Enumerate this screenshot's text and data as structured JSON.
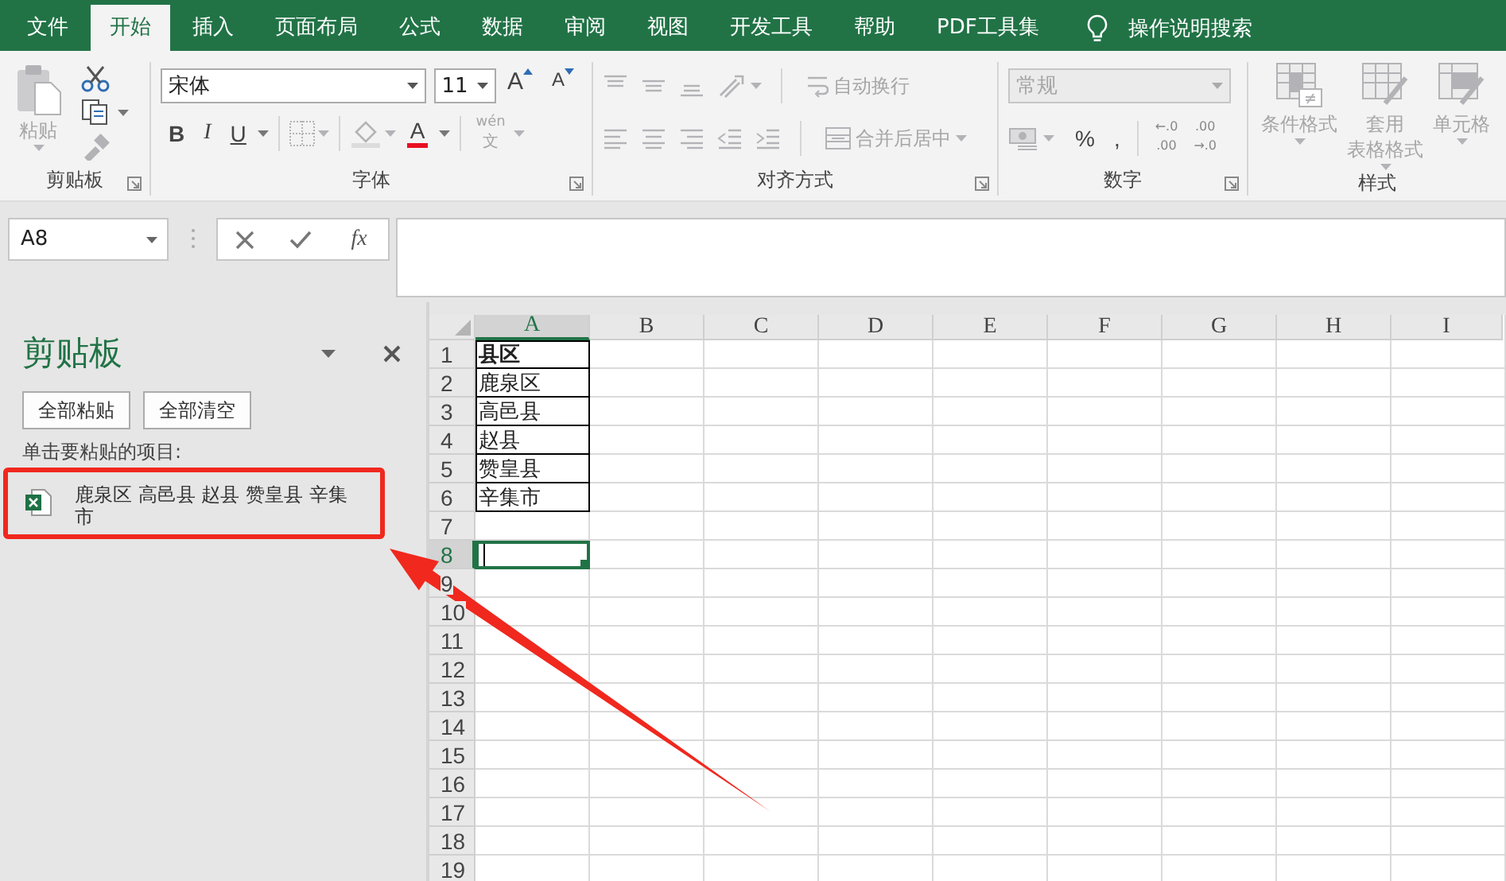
{
  "tabs": [
    {
      "label": "文件",
      "selected": false
    },
    {
      "label": "开始",
      "selected": true
    },
    {
      "label": "插入",
      "selected": false
    },
    {
      "label": "页面布局",
      "selected": false
    },
    {
      "label": "公式",
      "selected": false
    },
    {
      "label": "数据",
      "selected": false
    },
    {
      "label": "审阅",
      "selected": false
    },
    {
      "label": "视图",
      "selected": false
    },
    {
      "label": "开发工具",
      "selected": false
    },
    {
      "label": "帮助",
      "selected": false
    },
    {
      "label": "PDF工具集",
      "selected": false
    }
  ],
  "tell_me": {
    "label": "操作说明搜索"
  },
  "ribbon": {
    "clipboard": {
      "label": "剪贴板",
      "launcher": true,
      "paste": {
        "label": "粘贴",
        "disabled": true
      },
      "format_painter": {
        "disabled": true
      }
    },
    "font": {
      "label": "字体",
      "launcher": true,
      "font_name": "宋体",
      "font_size": "11",
      "size_buttons": [
        {
          "kind": "grow",
          "label": "A"
        },
        {
          "kind": "shrink",
          "label": "A"
        }
      ],
      "style_buttons": [
        {
          "kind": "bold",
          "label": "B"
        },
        {
          "kind": "italic",
          "label": "I"
        },
        {
          "kind": "underline",
          "label": "U"
        }
      ],
      "font_color": {
        "label": "A"
      },
      "phonetic": {
        "top": "wén",
        "bottom": "文",
        "disabled": true
      }
    },
    "alignment": {
      "label": "对齐方式",
      "launcher": true,
      "wrap_text": {
        "label": "自动换行",
        "disabled": true
      },
      "merge": {
        "label": "合并后居中",
        "disabled": true
      }
    },
    "number": {
      "label": "数字",
      "launcher": true,
      "format": {
        "value": "常规",
        "disabled": true
      },
      "percent": "%",
      "comma": ",",
      "decimals": [
        {
          "top": "←.0",
          "bottom": ".00"
        },
        {
          "top": ".00",
          "bottom": "→.0"
        }
      ]
    },
    "styles": {
      "label": "样式",
      "launcher": false,
      "buttons": [
        {
          "label": "条件格式",
          "disabled": true
        },
        {
          "label": "套用",
          "label_line_2": "表格格式",
          "disabled": true
        },
        {
          "label": "单元格",
          "disabled": true
        }
      ]
    }
  },
  "formula_bar": {
    "name_box": "A8",
    "function_button": "fx"
  },
  "pane": {
    "title": "剪贴板",
    "buttons": [
      "全部粘贴",
      "全部清空"
    ],
    "hint": "单击要粘贴的项目:",
    "items": [
      {
        "text": "鹿泉区 高邑县 赵县 赞皇县 辛集市",
        "highlighted": true
      }
    ]
  },
  "sheet": {
    "columns": [
      {
        "label": "A",
        "selected": true
      },
      {
        "label": "B",
        "selected": false
      },
      {
        "label": "C",
        "selected": false
      },
      {
        "label": "D",
        "selected": false
      },
      {
        "label": "E",
        "selected": false
      },
      {
        "label": "F",
        "selected": false
      },
      {
        "label": "G",
        "selected": false
      },
      {
        "label": "H",
        "selected": false
      },
      {
        "label": "I",
        "selected": false
      }
    ],
    "rows": [
      {
        "label": "1",
        "selected": false,
        "cells": [
          {
            "text": "县区",
            "bold": true,
            "bordered": true
          }
        ]
      },
      {
        "label": "2",
        "selected": false,
        "cells": [
          {
            "text": "鹿泉区",
            "bold": false,
            "bordered": true
          }
        ]
      },
      {
        "label": "3",
        "selected": false,
        "cells": [
          {
            "text": "高邑县",
            "bold": false,
            "bordered": true
          }
        ]
      },
      {
        "label": "4",
        "selected": false,
        "cells": [
          {
            "text": "赵县",
            "bold": false,
            "bordered": true
          }
        ]
      },
      {
        "label": "5",
        "selected": false,
        "cells": [
          {
            "text": "赞皇县",
            "bold": false,
            "bordered": true
          }
        ]
      },
      {
        "label": "6",
        "selected": false,
        "cells": [
          {
            "text": "辛集市",
            "bold": false,
            "bordered": true
          }
        ]
      },
      {
        "label": "7",
        "selected": false
      },
      {
        "label": "8",
        "selected": true
      },
      {
        "label": "9",
        "selected": false
      },
      {
        "label": "10",
        "selected": false
      },
      {
        "label": "11",
        "selected": false
      },
      {
        "label": "12",
        "selected": false
      },
      {
        "label": "13",
        "selected": false
      },
      {
        "label": "14",
        "selected": false
      },
      {
        "label": "15",
        "selected": false
      },
      {
        "label": "16",
        "selected": false
      },
      {
        "label": "17",
        "selected": false
      },
      {
        "label": "18",
        "selected": false
      },
      {
        "label": "19",
        "selected": false
      }
    ]
  },
  "annotations": [
    {
      "kind": "arrow"
    }
  ]
}
